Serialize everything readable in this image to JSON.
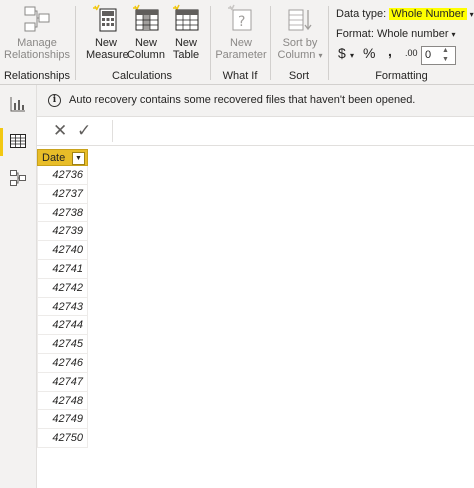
{
  "ribbon": {
    "relationships": {
      "manage_label_1": "Manage",
      "manage_label_2": "Relationships",
      "group_label": "Relationships"
    },
    "calculations": {
      "new_measure_1": "New",
      "new_measure_2": "Measure",
      "new_column_1": "New",
      "new_column_2": "Column",
      "new_table_1": "New",
      "new_table_2": "Table",
      "group_label": "Calculations"
    },
    "whatif": {
      "new_parameter_1": "New",
      "new_parameter_2": "Parameter",
      "group_label": "What If"
    },
    "sort": {
      "sort_by_1": "Sort by",
      "sort_by_2": "Column",
      "group_label": "Sort"
    },
    "formatting": {
      "data_type_label": "Data type:",
      "data_type_value": "Whole Number",
      "format_label": "Format: Whole number",
      "currency_symbol": "$",
      "percent_symbol": "%",
      "comma_symbol": ",",
      "decimal_symbol": ".00",
      "decimal_places": "0",
      "group_label": "Formatting",
      "highlight_color": "#ffff00"
    }
  },
  "notification": {
    "message": "Auto recovery contains some recovered files that haven't been opened."
  },
  "table": {
    "column_header": "Date",
    "header_color": "#e8bd28",
    "rows": [
      "42736",
      "42737",
      "42738",
      "42739",
      "42740",
      "42741",
      "42742",
      "42743",
      "42744",
      "42745",
      "42746",
      "42747",
      "42748",
      "42749",
      "42750"
    ]
  }
}
